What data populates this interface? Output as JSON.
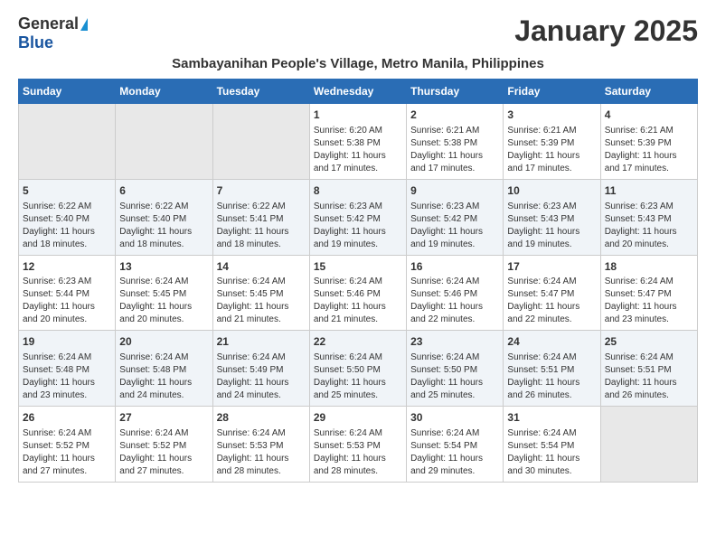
{
  "header": {
    "logo_general": "General",
    "logo_blue": "Blue",
    "month_title": "January 2025",
    "location": "Sambayanihan People's Village, Metro Manila, Philippines"
  },
  "days_of_week": [
    "Sunday",
    "Monday",
    "Tuesday",
    "Wednesday",
    "Thursday",
    "Friday",
    "Saturday"
  ],
  "weeks": [
    [
      {
        "day": "",
        "info": ""
      },
      {
        "day": "",
        "info": ""
      },
      {
        "day": "",
        "info": ""
      },
      {
        "day": "1",
        "info": "Sunrise: 6:20 AM\nSunset: 5:38 PM\nDaylight: 11 hours and 17 minutes."
      },
      {
        "day": "2",
        "info": "Sunrise: 6:21 AM\nSunset: 5:38 PM\nDaylight: 11 hours and 17 minutes."
      },
      {
        "day": "3",
        "info": "Sunrise: 6:21 AM\nSunset: 5:39 PM\nDaylight: 11 hours and 17 minutes."
      },
      {
        "day": "4",
        "info": "Sunrise: 6:21 AM\nSunset: 5:39 PM\nDaylight: 11 hours and 17 minutes."
      }
    ],
    [
      {
        "day": "5",
        "info": "Sunrise: 6:22 AM\nSunset: 5:40 PM\nDaylight: 11 hours and 18 minutes."
      },
      {
        "day": "6",
        "info": "Sunrise: 6:22 AM\nSunset: 5:40 PM\nDaylight: 11 hours and 18 minutes."
      },
      {
        "day": "7",
        "info": "Sunrise: 6:22 AM\nSunset: 5:41 PM\nDaylight: 11 hours and 18 minutes."
      },
      {
        "day": "8",
        "info": "Sunrise: 6:23 AM\nSunset: 5:42 PM\nDaylight: 11 hours and 19 minutes."
      },
      {
        "day": "9",
        "info": "Sunrise: 6:23 AM\nSunset: 5:42 PM\nDaylight: 11 hours and 19 minutes."
      },
      {
        "day": "10",
        "info": "Sunrise: 6:23 AM\nSunset: 5:43 PM\nDaylight: 11 hours and 19 minutes."
      },
      {
        "day": "11",
        "info": "Sunrise: 6:23 AM\nSunset: 5:43 PM\nDaylight: 11 hours and 20 minutes."
      }
    ],
    [
      {
        "day": "12",
        "info": "Sunrise: 6:23 AM\nSunset: 5:44 PM\nDaylight: 11 hours and 20 minutes."
      },
      {
        "day": "13",
        "info": "Sunrise: 6:24 AM\nSunset: 5:45 PM\nDaylight: 11 hours and 20 minutes."
      },
      {
        "day": "14",
        "info": "Sunrise: 6:24 AM\nSunset: 5:45 PM\nDaylight: 11 hours and 21 minutes."
      },
      {
        "day": "15",
        "info": "Sunrise: 6:24 AM\nSunset: 5:46 PM\nDaylight: 11 hours and 21 minutes."
      },
      {
        "day": "16",
        "info": "Sunrise: 6:24 AM\nSunset: 5:46 PM\nDaylight: 11 hours and 22 minutes."
      },
      {
        "day": "17",
        "info": "Sunrise: 6:24 AM\nSunset: 5:47 PM\nDaylight: 11 hours and 22 minutes."
      },
      {
        "day": "18",
        "info": "Sunrise: 6:24 AM\nSunset: 5:47 PM\nDaylight: 11 hours and 23 minutes."
      }
    ],
    [
      {
        "day": "19",
        "info": "Sunrise: 6:24 AM\nSunset: 5:48 PM\nDaylight: 11 hours and 23 minutes."
      },
      {
        "day": "20",
        "info": "Sunrise: 6:24 AM\nSunset: 5:48 PM\nDaylight: 11 hours and 24 minutes."
      },
      {
        "day": "21",
        "info": "Sunrise: 6:24 AM\nSunset: 5:49 PM\nDaylight: 11 hours and 24 minutes."
      },
      {
        "day": "22",
        "info": "Sunrise: 6:24 AM\nSunset: 5:50 PM\nDaylight: 11 hours and 25 minutes."
      },
      {
        "day": "23",
        "info": "Sunrise: 6:24 AM\nSunset: 5:50 PM\nDaylight: 11 hours and 25 minutes."
      },
      {
        "day": "24",
        "info": "Sunrise: 6:24 AM\nSunset: 5:51 PM\nDaylight: 11 hours and 26 minutes."
      },
      {
        "day": "25",
        "info": "Sunrise: 6:24 AM\nSunset: 5:51 PM\nDaylight: 11 hours and 26 minutes."
      }
    ],
    [
      {
        "day": "26",
        "info": "Sunrise: 6:24 AM\nSunset: 5:52 PM\nDaylight: 11 hours and 27 minutes."
      },
      {
        "day": "27",
        "info": "Sunrise: 6:24 AM\nSunset: 5:52 PM\nDaylight: 11 hours and 27 minutes."
      },
      {
        "day": "28",
        "info": "Sunrise: 6:24 AM\nSunset: 5:53 PM\nDaylight: 11 hours and 28 minutes."
      },
      {
        "day": "29",
        "info": "Sunrise: 6:24 AM\nSunset: 5:53 PM\nDaylight: 11 hours and 28 minutes."
      },
      {
        "day": "30",
        "info": "Sunrise: 6:24 AM\nSunset: 5:54 PM\nDaylight: 11 hours and 29 minutes."
      },
      {
        "day": "31",
        "info": "Sunrise: 6:24 AM\nSunset: 5:54 PM\nDaylight: 11 hours and 30 minutes."
      },
      {
        "day": "",
        "info": ""
      }
    ]
  ]
}
